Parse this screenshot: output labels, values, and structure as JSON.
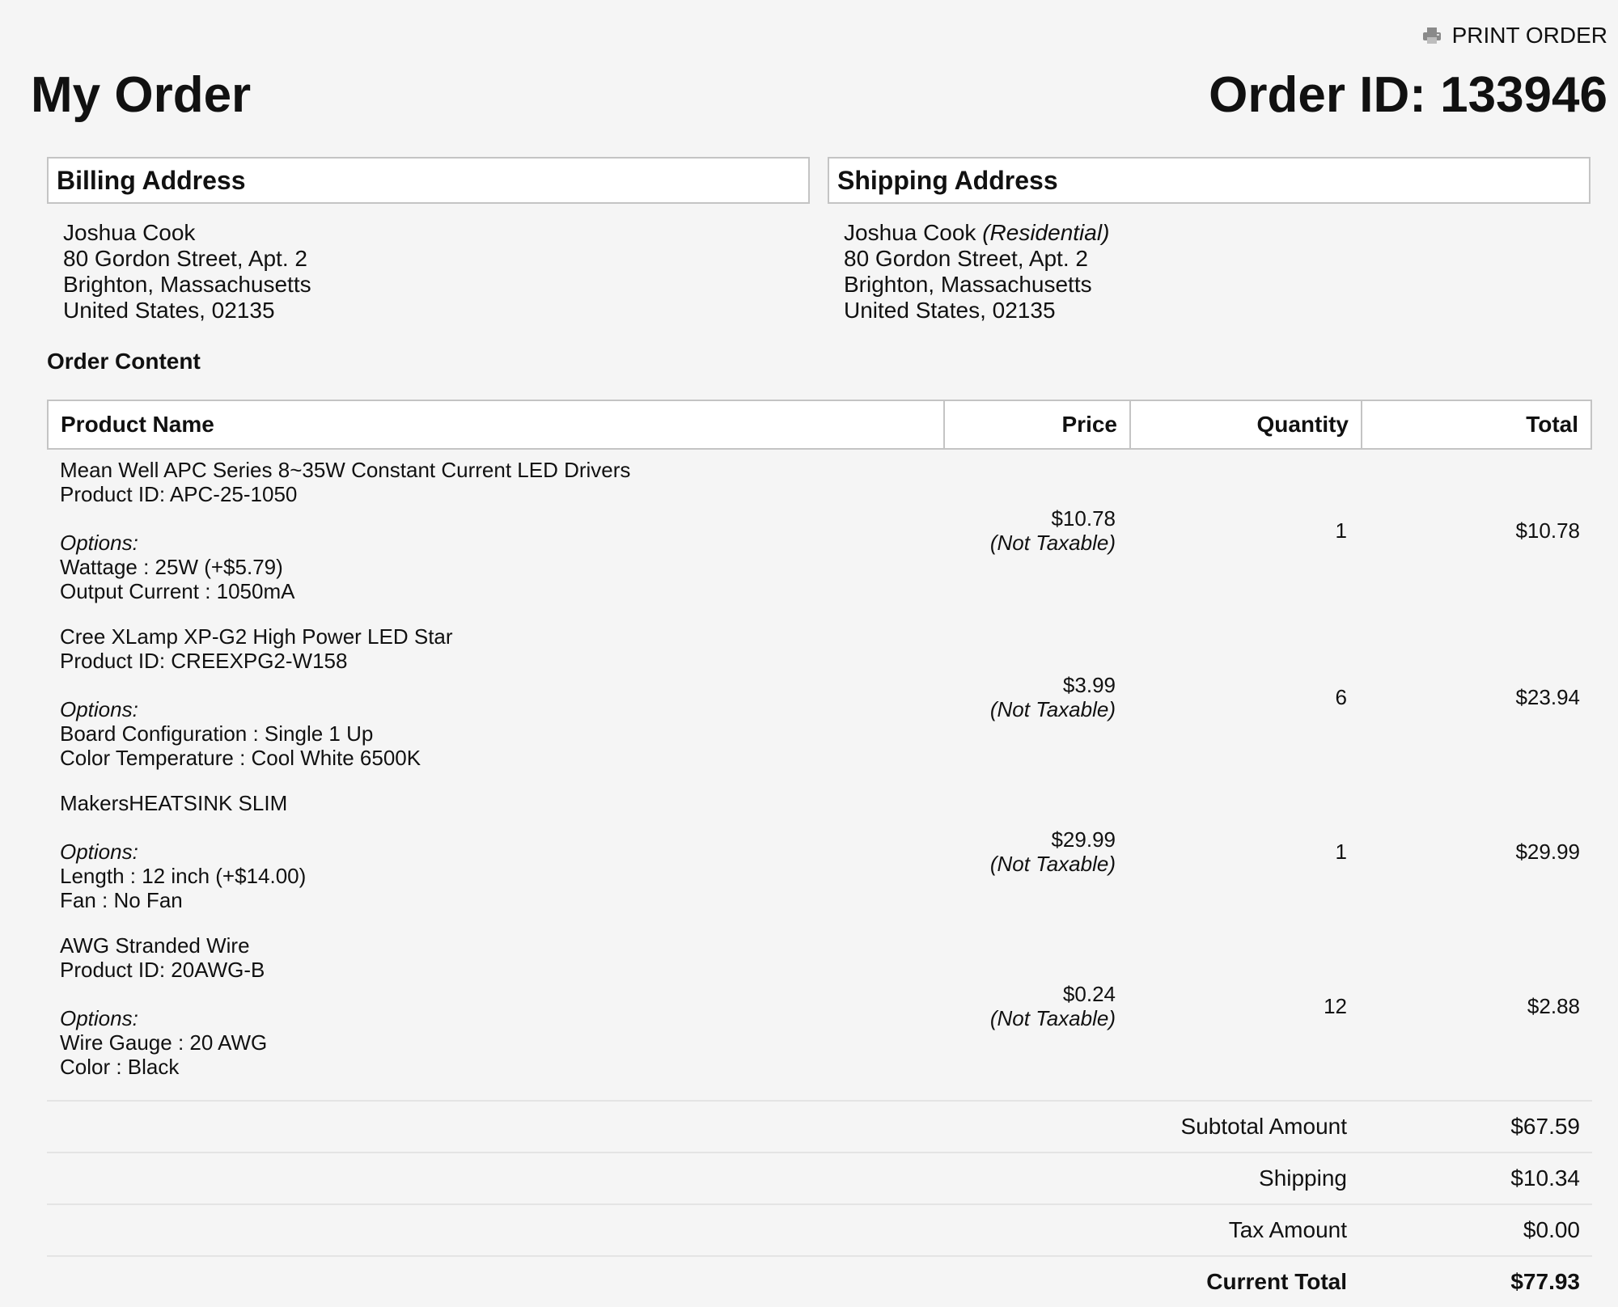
{
  "header": {
    "print_label": "PRINT ORDER",
    "page_title": "My Order",
    "order_id": "Order ID: 133946"
  },
  "billing": {
    "title": "Billing Address",
    "name": "Joshua Cook",
    "street": "80 Gordon Street, Apt. 2",
    "city": "Brighton, Massachusetts",
    "country": "United States, 02135"
  },
  "shipping": {
    "title": "Shipping Address",
    "name": "Joshua Cook",
    "type": "(Residential)",
    "street": "80 Gordon Street, Apt. 2",
    "city": "Brighton, Massachusetts",
    "country": "United States, 02135"
  },
  "order_content": {
    "title": "Order Content",
    "columns": {
      "name": "Product Name",
      "price": "Price",
      "quantity": "Quantity",
      "total": "Total"
    },
    "items": [
      {
        "name": "Mean Well APC Series 8~35W Constant Current LED Drivers",
        "product_id": "Product ID: APC-25-1050",
        "options_label": "Options:",
        "options": [
          "Wattage : 25W (+$5.79)",
          "Output Current : 1050mA"
        ],
        "price": "$10.78",
        "tax_note": "(Not Taxable)",
        "quantity": "1",
        "total": "$10.78"
      },
      {
        "name": "Cree XLamp XP-G2 High Power LED Star",
        "product_id": "Product ID: CREEXPG2-W158",
        "options_label": "Options:",
        "options": [
          "Board Configuration : Single 1 Up",
          "Color Temperature : Cool White 6500K"
        ],
        "price": "$3.99",
        "tax_note": "(Not Taxable)",
        "quantity": "6",
        "total": "$23.94"
      },
      {
        "name": "MakersHEATSINK SLIM",
        "product_id": "",
        "options_label": "Options:",
        "options": [
          "Length : 12 inch (+$14.00)",
          "Fan : No Fan"
        ],
        "price": "$29.99",
        "tax_note": "(Not Taxable)",
        "quantity": "1",
        "total": "$29.99"
      },
      {
        "name": "AWG Stranded Wire",
        "product_id": "Product ID: 20AWG-B",
        "options_label": "Options:",
        "options": [
          "Wire Gauge : 20 AWG",
          "Color : Black"
        ],
        "price": "$0.24",
        "tax_note": "(Not Taxable)",
        "quantity": "12",
        "total": "$2.88"
      }
    ]
  },
  "summary": {
    "subtotal_label": "Subtotal Amount",
    "subtotal_value": "$67.59",
    "shipping_label": "Shipping",
    "shipping_value": "$10.34",
    "tax_label": "Tax Amount",
    "tax_value": "$0.00",
    "total_label": "Current Total",
    "total_value": "$77.93"
  }
}
